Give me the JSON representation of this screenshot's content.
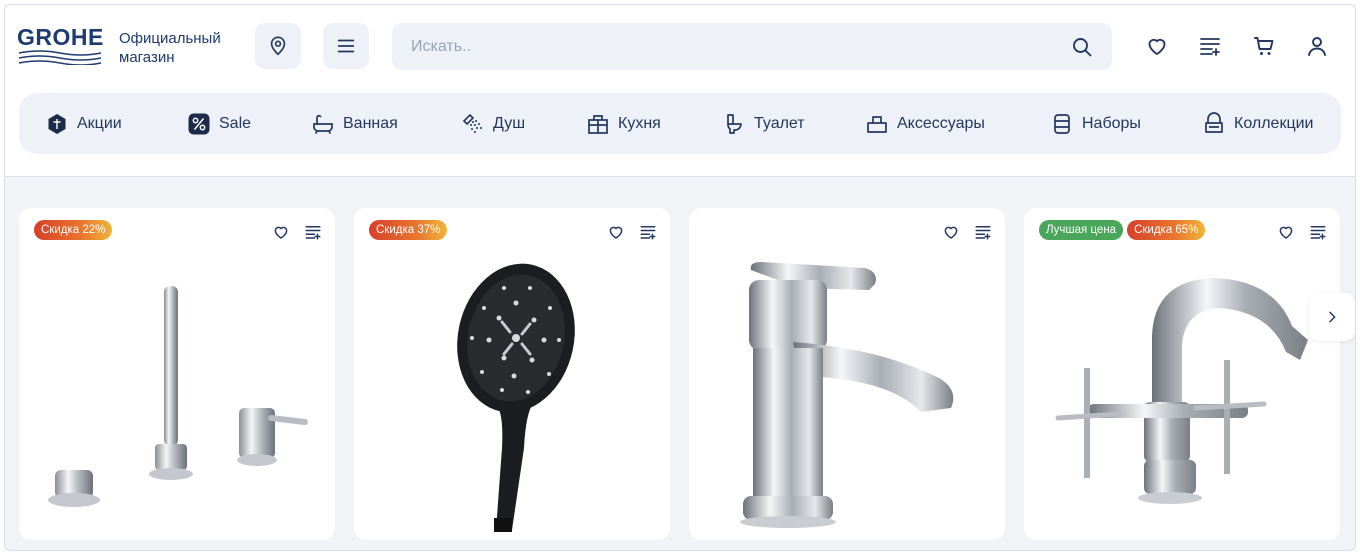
{
  "brand": {
    "logo": "GROHE",
    "store_line1": "Официальный",
    "store_line2": "магазин"
  },
  "search": {
    "placeholder": "Искать.."
  },
  "header_icons": [
    "location-icon",
    "menu-icon",
    "search-icon",
    "heart-icon",
    "compare-icon",
    "cart-icon",
    "user-icon"
  ],
  "categories": [
    {
      "label": "Акции",
      "icon": "promo-icon"
    },
    {
      "label": "Sale",
      "icon": "percent-icon"
    },
    {
      "label": "Ванная",
      "icon": "bathtub-icon"
    },
    {
      "label": "Душ",
      "icon": "shower-icon"
    },
    {
      "label": "Кухня",
      "icon": "kitchen-icon"
    },
    {
      "label": "Туалет",
      "icon": "toilet-icon"
    },
    {
      "label": "Аксессуары",
      "icon": "accessory-icon"
    },
    {
      "label": "Наборы",
      "icon": "sets-icon"
    },
    {
      "label": "Коллекции",
      "icon": "collection-icon"
    }
  ],
  "products": [
    {
      "badges": [
        {
          "text": "Скидка 22%",
          "type": "discount"
        }
      ],
      "image": "bath-mixer-set"
    },
    {
      "badges": [
        {
          "text": "Скидка 37%",
          "type": "discount"
        }
      ],
      "image": "hand-shower-black"
    },
    {
      "badges": [],
      "image": "basin-tap-chrome"
    },
    {
      "badges": [
        {
          "text": "Лучшая цена",
          "type": "best"
        },
        {
          "text": "Скидка 65%",
          "type": "discount"
        }
      ],
      "image": "bidet-mixer-cross"
    }
  ],
  "colors": {
    "brand": "#1e3a6e",
    "surface": "#eef1f7",
    "best": "#4aa65a",
    "discount_start": "#d6402a",
    "discount_end": "#f0b43a"
  }
}
